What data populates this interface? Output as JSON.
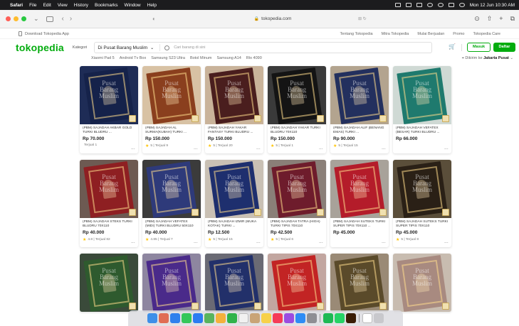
{
  "menubar": {
    "app": "Safari",
    "items": [
      "File",
      "Edit",
      "View",
      "History",
      "Bookmarks",
      "Window",
      "Help"
    ],
    "clock": "Mon 12 Jun  10:30 AM"
  },
  "browser": {
    "url": "tokopedia.com",
    "lock_symbol": "🔒"
  },
  "topstrip": {
    "download": "Download Tokopedia App",
    "links": [
      "Tentang Tokopedia",
      "Mitra Tokopedia",
      "Mulai Berjualan",
      "Promo",
      "Tokopedia Care"
    ]
  },
  "header": {
    "logo": "tokopedia",
    "kategori": "Kategori",
    "scope": "Di Pusat Barang Muslim",
    "search_placeholder": "Cari barang di sini",
    "login": "Masuk",
    "register": "Daftar"
  },
  "suggestions": [
    "Xiaomi Pad 5",
    "Android Tv Box",
    "Samsung S23 Ultra",
    "Botol Minum",
    "Samsung A14",
    "Rtx 4090"
  ],
  "shipping": {
    "prefix": "Dikirim ke",
    "place": "Jakarta Pusat"
  },
  "watermark": [
    "Pusat",
    "Barang",
    "Muslim"
  ],
  "colors": {
    "brand": "#03ac0e",
    "star": "#ffc400"
  },
  "products": [
    {
      "name": "(PBM) SAJADAH AKBAR GOLD TURKI BLUDRU ...",
      "price": "Rp 70.000",
      "meta": "Terjual 1",
      "rating": "",
      "bg": "#1e2c56",
      "rug": "#15224a"
    },
    {
      "name": "(PBM) SAJADAH AL SURMA(KUBAH) TURKI ...",
      "price": "Rp 150.000",
      "meta": "5 | Terjual 9",
      "rating": "★",
      "bg": "#d8c2a4",
      "rug": "#8a3f1e"
    },
    {
      "name": "(PBM) SAJADAH YAKAR FANTASY TURKI BLUDRU ...",
      "price": "Rp 150.000",
      "meta": "5 | Terjual 20",
      "rating": "★",
      "bg": "#c9b39a",
      "rug": "#4a1e1e"
    },
    {
      "name": "(PBM) SAJADAH YAKAR TURKI BLUDRU 70X110",
      "price": "Rp 150.000",
      "meta": "5 | Terjual 1",
      "rating": "★",
      "bg": "#3a3a3a",
      "rug": "#141414"
    },
    {
      "name": "(PBM) SAJADAH ALIF (BENANG EMAS) TURKI ...",
      "price": "Rp 90.000",
      "meta": "5 | Terjual 15",
      "rating": "★",
      "bg": "#b3a48f",
      "rug": "#23305e"
    },
    {
      "name": "(PBM) SAJADAH VEFATEX (BESAR) TURKI BLUDRU ...",
      "price": "Rp 66.000",
      "meta": "",
      "rating": "",
      "bg": "#cfd9d4",
      "rug": "#1f7a6e"
    },
    {
      "name": "(PBM) SAJADAH STEKS TURKI BLUDRU 70X110",
      "price": "Rp 40.000",
      "meta": "4.8 | Terjual 82",
      "rating": "★",
      "bg": "#6d5a52",
      "rug": "#8e1f22"
    },
    {
      "name": "(PBM) SAJADAH VEFATEX (MIDI) TURKI BLUDRU 50X110",
      "price": "Rp 40.000",
      "meta": "4.85 | Terjual 7",
      "rating": "★",
      "bg": "#3b3b3b",
      "rug": "#2e3a7a"
    },
    {
      "name": "(PBM) SAJADAH IZMIR (MUKA KOTAK) TURKI ...",
      "price": "Rp 12.500",
      "meta": "5 | Terjual 15",
      "rating": "★",
      "bg": "#c9c0b4",
      "rug": "#1e2f6e"
    },
    {
      "name": "(PBM) SAJADAH TATRA (HIGH) TURKI TIPIS 70X110",
      "price": "Rp 42.500",
      "meta": "5 | Terjual 6",
      "rating": "★",
      "bg": "#8a7f78",
      "rug": "#6e1c2c"
    },
    {
      "name": "(PBM) SAJADAH SUTEKS TURKI SUPER TIPIS 70X110 ...",
      "price": "Rp 45.000",
      "meta": "",
      "rating": "",
      "bg": "#a8a29a",
      "rug": "#b41c2a"
    },
    {
      "name": "(PBM) SAJADAH SUTEKS TURKI SUPER TIPIS 70X110",
      "price": "Rp 45.000",
      "meta": "5 | Terjual 8",
      "rating": "★",
      "bg": "#5a4e3a",
      "rug": "#2a2016"
    },
    {
      "name": "",
      "price": "",
      "meta": "",
      "rating": "",
      "bg": "#3a4a3a",
      "rug": "#2e5a2e"
    },
    {
      "name": "",
      "price": "",
      "meta": "",
      "rating": "",
      "bg": "#8e86a0",
      "rug": "#4a2a8a"
    },
    {
      "name": "",
      "price": "",
      "meta": "",
      "rating": "",
      "bg": "#6a6a74",
      "rug": "#22306a"
    },
    {
      "name": "",
      "price": "",
      "meta": "",
      "rating": "",
      "bg": "#c2a6a0",
      "rug": "#c22424"
    },
    {
      "name": "",
      "price": "",
      "meta": "",
      "rating": "",
      "bg": "#9a8a76",
      "rug": "#5a4a2a"
    },
    {
      "name": "",
      "price": "",
      "meta": "",
      "rating": "",
      "bg": "#c8bcb0",
      "rug": "#a88a80"
    }
  ],
  "dock": {
    "apps": [
      {
        "name": "finder",
        "color": "#3e8fe8"
      },
      {
        "name": "launchpad",
        "color": "#e06d54"
      },
      {
        "name": "safari",
        "color": "#2f80ed"
      },
      {
        "name": "messages",
        "color": "#34c759"
      },
      {
        "name": "mail",
        "color": "#2b7cf2"
      },
      {
        "name": "maps",
        "color": "#58b45e"
      },
      {
        "name": "photos",
        "color": "#f4b13c"
      },
      {
        "name": "facetime",
        "color": "#30b34a"
      },
      {
        "name": "calendar",
        "color": "#f1f1f1"
      },
      {
        "name": "contacts",
        "color": "#c9a477"
      },
      {
        "name": "notes",
        "color": "#f7d14a"
      },
      {
        "name": "music",
        "color": "#f53b57"
      },
      {
        "name": "podcasts",
        "color": "#9b4ce0"
      },
      {
        "name": "appstore",
        "color": "#2e8cf5"
      },
      {
        "name": "settings",
        "color": "#8e8e93"
      },
      {
        "name": "spotify",
        "color": "#1db954"
      },
      {
        "name": "whatsapp",
        "color": "#25d366"
      },
      {
        "name": "illustrator",
        "color": "#3a1d05"
      },
      {
        "name": "document",
        "color": "#ffffff"
      },
      {
        "name": "trash",
        "color": "#c8c8cc"
      }
    ]
  }
}
